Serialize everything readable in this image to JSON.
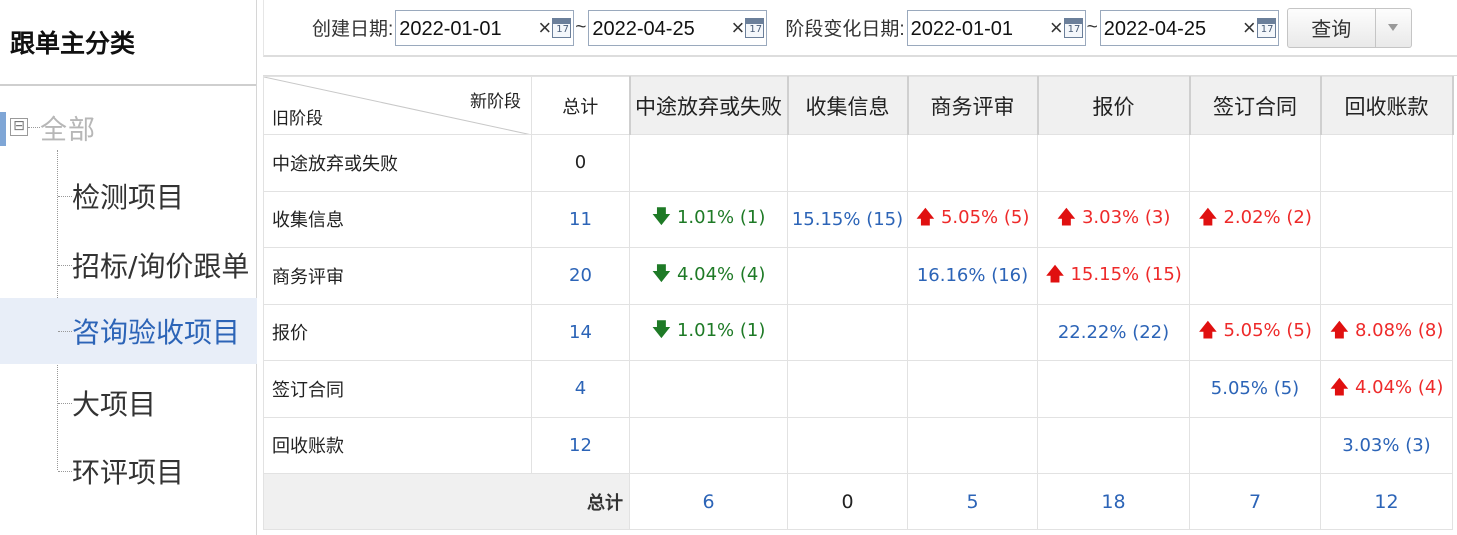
{
  "sidebar": {
    "title": "跟单主分类",
    "root": {
      "toggle": "⊟",
      "label": "全部"
    },
    "items": [
      {
        "label": "检测项目",
        "active": false
      },
      {
        "label": "招标/询价跟单",
        "active": false
      },
      {
        "label": "咨询验收项目",
        "active": true
      },
      {
        "label": "大项目",
        "active": false
      },
      {
        "label": "环评项目",
        "active": false
      }
    ]
  },
  "filters": {
    "create_label": "创建日期:",
    "create_from": "2022-01-01",
    "create_to": "2022-04-25",
    "change_label": "阶段变化日期:",
    "change_from": "2022-01-01",
    "change_to": "2022-04-25",
    "tilde": "~",
    "clear_glyph": "×",
    "query_label": "查询"
  },
  "table": {
    "corner_new": "新阶段",
    "corner_old": "旧阶段",
    "total_header": "总计",
    "columns": [
      "中途放弃或失败",
      "收集信息",
      "商务评审",
      "报价",
      "签订合同",
      "回收账款"
    ],
    "rows": [
      {
        "label": "中途放弃或失败",
        "total": "0",
        "cells": [
          {
            "text": "",
            "dir": "none",
            "tone": ""
          },
          {
            "text": "",
            "dir": "none",
            "tone": ""
          },
          {
            "text": "",
            "dir": "none",
            "tone": ""
          },
          {
            "text": "",
            "dir": "none",
            "tone": ""
          },
          {
            "text": "",
            "dir": "none",
            "tone": ""
          },
          {
            "text": "",
            "dir": "none",
            "tone": ""
          }
        ]
      },
      {
        "label": "收集信息",
        "total": "11",
        "cells": [
          {
            "text": "1.01% (1)",
            "dir": "down",
            "tone": "green"
          },
          {
            "text": "15.15% (15)",
            "dir": "none",
            "tone": "blue"
          },
          {
            "text": "5.05% (5)",
            "dir": "up",
            "tone": "red"
          },
          {
            "text": "3.03% (3)",
            "dir": "up",
            "tone": "red"
          },
          {
            "text": "2.02% (2)",
            "dir": "up",
            "tone": "red"
          },
          {
            "text": "",
            "dir": "none",
            "tone": ""
          }
        ]
      },
      {
        "label": "商务评审",
        "total": "20",
        "cells": [
          {
            "text": "4.04% (4)",
            "dir": "down",
            "tone": "green"
          },
          {
            "text": "",
            "dir": "none",
            "tone": ""
          },
          {
            "text": "16.16% (16)",
            "dir": "none",
            "tone": "blue"
          },
          {
            "text": "15.15% (15)",
            "dir": "up",
            "tone": "red"
          },
          {
            "text": "",
            "dir": "none",
            "tone": ""
          },
          {
            "text": "",
            "dir": "none",
            "tone": ""
          }
        ]
      },
      {
        "label": "报价",
        "total": "14",
        "cells": [
          {
            "text": "1.01% (1)",
            "dir": "down",
            "tone": "green"
          },
          {
            "text": "",
            "dir": "none",
            "tone": ""
          },
          {
            "text": "",
            "dir": "none",
            "tone": ""
          },
          {
            "text": "22.22% (22)",
            "dir": "none",
            "tone": "blue"
          },
          {
            "text": "5.05% (5)",
            "dir": "up",
            "tone": "red"
          },
          {
            "text": "8.08% (8)",
            "dir": "up",
            "tone": "red"
          }
        ]
      },
      {
        "label": "签订合同",
        "total": "4",
        "cells": [
          {
            "text": "",
            "dir": "none",
            "tone": ""
          },
          {
            "text": "",
            "dir": "none",
            "tone": ""
          },
          {
            "text": "",
            "dir": "none",
            "tone": ""
          },
          {
            "text": "",
            "dir": "none",
            "tone": ""
          },
          {
            "text": "5.05% (5)",
            "dir": "none",
            "tone": "blue"
          },
          {
            "text": "4.04% (4)",
            "dir": "up",
            "tone": "red"
          }
        ]
      },
      {
        "label": "回收账款",
        "total": "12",
        "cells": [
          {
            "text": "",
            "dir": "none",
            "tone": ""
          },
          {
            "text": "",
            "dir": "none",
            "tone": ""
          },
          {
            "text": "",
            "dir": "none",
            "tone": ""
          },
          {
            "text": "",
            "dir": "none",
            "tone": ""
          },
          {
            "text": "",
            "dir": "none",
            "tone": ""
          },
          {
            "text": "3.03% (3)",
            "dir": "none",
            "tone": "blue"
          }
        ]
      }
    ],
    "footer_label": "总计",
    "footer_values": [
      "6",
      "0",
      "5",
      "18",
      "7",
      "12"
    ]
  },
  "icons": {
    "arrow_up": "🡅",
    "arrow_down": "🡇",
    "up_name": "arrow-up-icon",
    "down_name": "arrow-down-icon"
  },
  "colors": {
    "up": "#ee2a2a",
    "down": "#1e7a26",
    "neutral": "#2c64b7"
  }
}
